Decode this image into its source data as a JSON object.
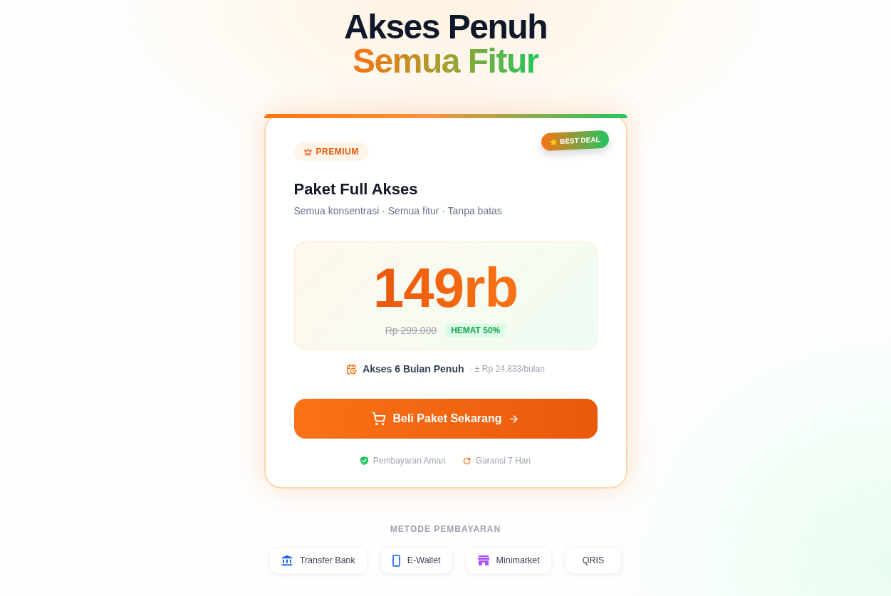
{
  "hero": {
    "title": "Akses Penuh",
    "highlight": "Semua Fitur"
  },
  "plan": {
    "ribbon": "BEST DEAL",
    "tier": "PREMIUM",
    "name": "Paket Full Akses",
    "tagline": "Semua konsentrasi · Semua fitur · Tanpa batas",
    "price": "149rb",
    "original_price": "Rp 299.000",
    "discount": "HEMAT 50%",
    "duration": "Akses 6 Bulan Penuh",
    "monthly": "· ± Rp 24.833/bulan",
    "cta": "Beli Paket Sekarang",
    "guarantees": [
      {
        "kind": "secure",
        "label": "Pembayaran Aman"
      },
      {
        "kind": "refund",
        "label": "Garansi 7 Hari"
      }
    ]
  },
  "payment": {
    "heading": "METODE PEMBAYARAN",
    "methods": [
      {
        "kind": "bank",
        "label": "Transfer Bank"
      },
      {
        "kind": "wallet",
        "label": "E-Wallet"
      },
      {
        "kind": "store",
        "label": "Minimarket"
      },
      {
        "kind": "qris",
        "label": "QRIS"
      }
    ]
  }
}
